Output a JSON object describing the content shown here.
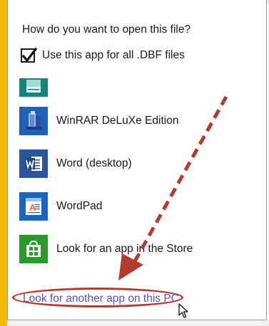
{
  "dialog": {
    "title": "How do you want to open this file?",
    "checkbox": {
      "label": "Use this app for all .DBF files",
      "checked": true
    },
    "apps": [
      {
        "name": "",
        "icon": "teal-app-icon",
        "partial": true
      },
      {
        "name": "WinRAR DeLuXe Edition",
        "icon": "winrar-icon",
        "tile_color": "#1e62b8"
      },
      {
        "name": "Word (desktop)",
        "icon": "word-icon",
        "tile_color": "#2b579a"
      },
      {
        "name": "WordPad",
        "icon": "wordpad-icon",
        "tile_color": "#1a64c2"
      },
      {
        "name": "Look for an app in the Store",
        "icon": "store-icon",
        "tile_color": "#2a9b2a"
      }
    ],
    "link": "Look for another app on this PC"
  },
  "annotation": {
    "arrow_color": "#b23b2f",
    "highlight_color": "#b23b2f"
  },
  "colors": {
    "accent_strip": "#f5b800",
    "link": "#5b4fc7"
  }
}
